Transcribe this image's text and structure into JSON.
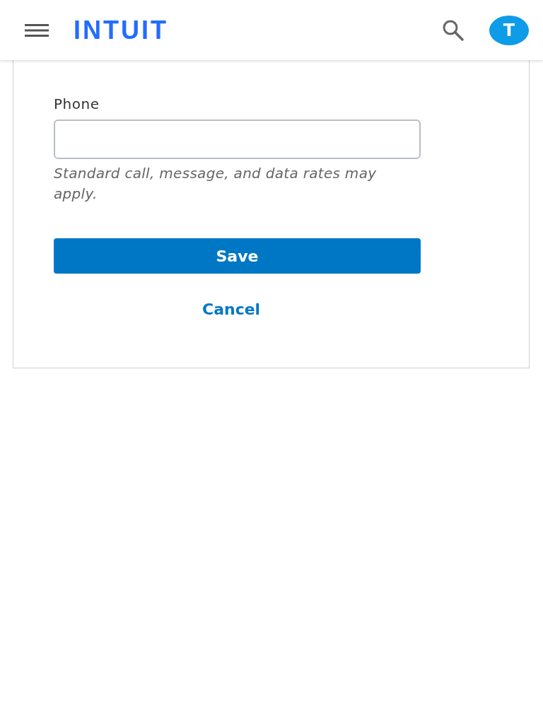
{
  "header": {
    "logo": "INTUIT",
    "avatar": "T"
  },
  "form": {
    "label": "Phone",
    "hint": "Standard call, message, and data rates may apply.",
    "save": "Save",
    "cancel": "Cancel"
  }
}
